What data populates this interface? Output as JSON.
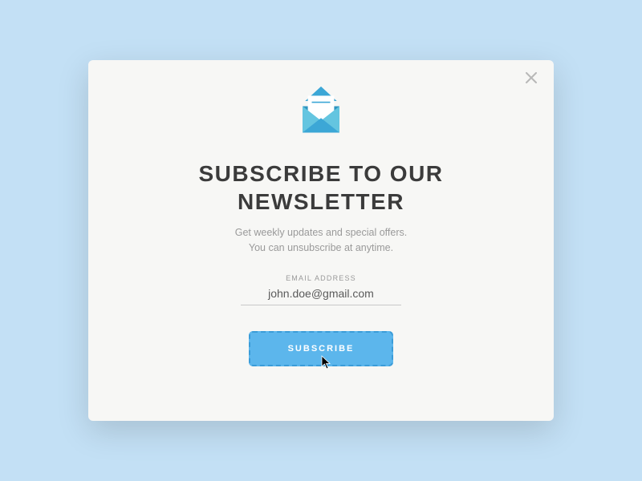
{
  "modal": {
    "title": "SUBSCRIBE TO OUR NEWSLETTER",
    "subtitle_line1": "Get weekly updates and special offers.",
    "subtitle_line2": "You can unsubscribe at anytime.",
    "email_label": "EMAIL ADDRESS",
    "email_value": "john.doe@gmail.com",
    "subscribe_label": "SUBSCRIBE"
  },
  "colors": {
    "background": "#c3e0f5",
    "modal_bg": "#f7f7f5",
    "title_text": "#3b3b3b",
    "muted_text": "#9a9a9a",
    "button_bg": "#5cb6ec",
    "button_border": "#3a9cd8",
    "envelope_primary": "#3ca7d6",
    "envelope_secondary": "#64c5e0"
  }
}
